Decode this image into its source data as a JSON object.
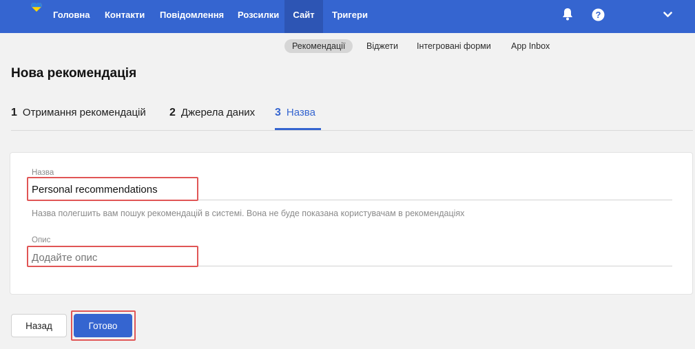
{
  "nav": {
    "items": [
      "Головна",
      "Контакти",
      "Повідомлення",
      "Розсилки",
      "Сайт",
      "Тригери"
    ],
    "active": "Сайт",
    "icons": [
      "bell-icon",
      "help-icon",
      "chevron-down-icon"
    ],
    "logo": "ukraine-heart-logo"
  },
  "subtabs": {
    "items": [
      "Рекомендації",
      "Віджети",
      "Інтегровані форми",
      "App Inbox"
    ],
    "active": "Рекомендації"
  },
  "page": {
    "title": "Нова рекомендація"
  },
  "steps": [
    {
      "num": "1",
      "label": "Отримання рекомендацій"
    },
    {
      "num": "2",
      "label": "Джерела даних"
    },
    {
      "num": "3",
      "label": "Назва"
    }
  ],
  "form": {
    "name": {
      "label": "Назва",
      "value": "Personal recommendations",
      "hint": "Назва полегшить вам пошук рекомендацій в системі. Вона не буде показана користувачам в рекомендаціях"
    },
    "description": {
      "label": "Опис",
      "value": "",
      "placeholder": "Додайте опис"
    }
  },
  "buttons": {
    "back": "Назад",
    "done": "Готово"
  },
  "colors": {
    "brand": "#3565d0",
    "highlight": "#e05555",
    "background": "#f2f2f2"
  }
}
